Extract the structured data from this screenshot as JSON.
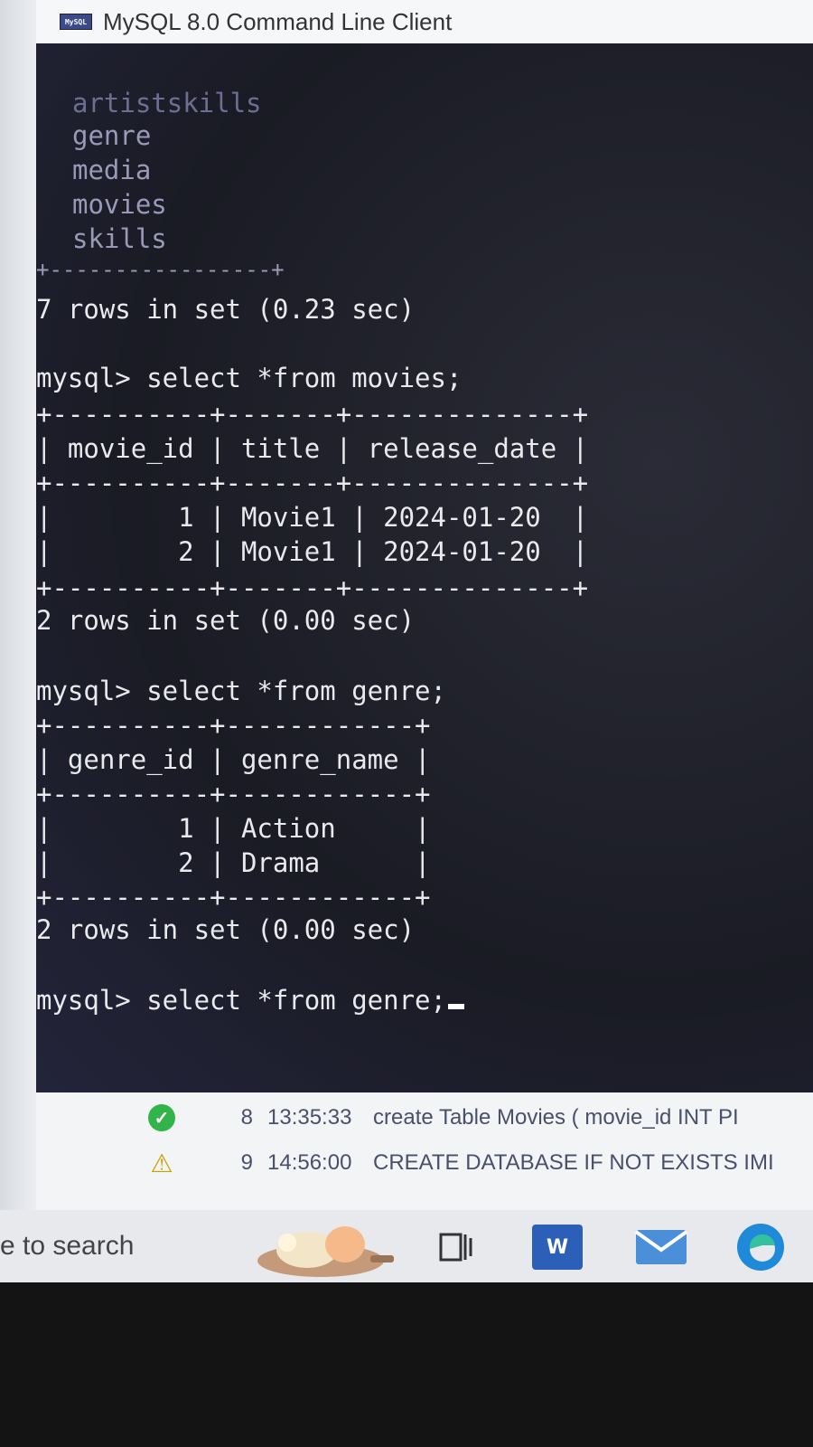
{
  "window": {
    "title": "MySQL 8.0 Command Line Client",
    "icon_label": "MySQL"
  },
  "console": {
    "lines": [
      "artistskills",
      "genre",
      "media",
      "movies",
      "skills",
      "+-----------------+",
      "7 rows in set (0.23 sec)",
      "",
      "mysql> select *from movies;",
      "+----------+-------+--------------+",
      "| movie_id | title | release_date |",
      "+----------+-------+--------------+",
      "|        1 | Movie1 | 2024-01-20  |",
      "|        2 | Movie1 | 2024-01-20  |",
      "+----------+-------+--------------+",
      "2 rows in set (0.00 sec)",
      "",
      "mysql> select *from genre;",
      "+----------+------------+",
      "| genre_id | genre_name |",
      "+----------+------------+",
      "|        1 | Action     |",
      "|        2 | Drama      |",
      "+----------+------------+",
      "2 rows in set (0.00 sec)",
      "",
      "mysql> select *from genre;"
    ]
  },
  "output_panel": {
    "rows": [
      {
        "status": "ok",
        "num": "8",
        "time": "13:35:33",
        "action": "create Table Movies (   movie_id INT PI"
      },
      {
        "status": "warning",
        "num": "9",
        "time": "14:56:00",
        "action": "CREATE DATABASE IF NOT EXISTS IMI"
      }
    ]
  },
  "taskbar": {
    "search_hint": "e to search",
    "icons": [
      "widgets-icon",
      "task-view-icon",
      "word-icon",
      "mail-icon",
      "edge-icon"
    ],
    "word_letter": "W"
  }
}
